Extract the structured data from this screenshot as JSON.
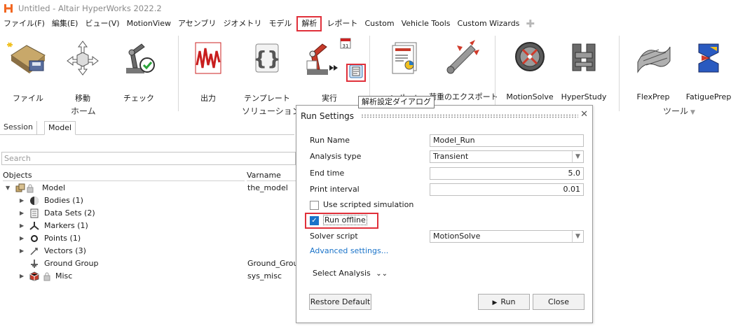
{
  "window": {
    "title": "Untitled - Altair HyperWorks 2022.2"
  },
  "menu": [
    "ファイル(F)",
    "編集(E)",
    "ビュー(V)",
    "MotionView",
    "アセンブリ",
    "ジオメトリ",
    "モデル",
    "解析",
    "レポート",
    "Custom",
    "Vehicle Tools",
    "Custom Wizards"
  ],
  "ribbon": {
    "home": {
      "file": "ファイル",
      "move": "移動",
      "check": "チェック",
      "group": "ホーム"
    },
    "solution": {
      "output": "出力",
      "template": "テンプレート",
      "run": "実行",
      "group": "ソリューション"
    },
    "report": {
      "report": "レポート",
      "load_export": "荷重のエクスポート"
    },
    "motion": {
      "motionsolve": "MotionSolve",
      "hyperstudy": "HyperStudy"
    },
    "tools": {
      "flexprep": "FlexPrep",
      "fatigueprep": "FatiguePrep",
      "group": "ツール"
    },
    "tooltip": "解析設定ダイアログ"
  },
  "browser": {
    "tabs": [
      "Session",
      "Model"
    ],
    "search_placeholder": "Search",
    "columns": {
      "objects": "Objects",
      "varname": "Varname"
    },
    "rows": [
      {
        "name": "Model",
        "varname": "the_model"
      },
      {
        "name": "Bodies (1)",
        "varname": ""
      },
      {
        "name": "Data Sets (2)",
        "varname": ""
      },
      {
        "name": "Markers (1)",
        "varname": ""
      },
      {
        "name": "Points (1)",
        "varname": ""
      },
      {
        "name": "Vectors (3)",
        "varname": ""
      },
      {
        "name": "Ground Group",
        "varname": "Ground_Group"
      },
      {
        "name": "Misc",
        "varname": "sys_misc"
      }
    ]
  },
  "dialog": {
    "title": "Run Settings",
    "run_name_label": "Run Name",
    "run_name_value": "Model_Run",
    "analysis_type_label": "Analysis type",
    "analysis_type_value": "Transient",
    "end_time_label": "End time",
    "end_time_value": "5.0",
    "print_interval_label": "Print interval",
    "print_interval_value": "0.01",
    "use_scripted_label": "Use scripted simulation",
    "use_scripted_checked": false,
    "run_offline_label": "Run offline",
    "run_offline_checked": true,
    "solver_script_label": "Solver script",
    "solver_script_value": "MotionSolve",
    "advanced_link": "Advanced settings...",
    "select_analysis": "Select Analysis",
    "restore_default": "Restore Default",
    "run_button": "Run",
    "close_button": "Close"
  },
  "colors": {
    "highlight": "#e0303a",
    "link": "#1a73c9",
    "checkbox": "#1a73c9"
  }
}
